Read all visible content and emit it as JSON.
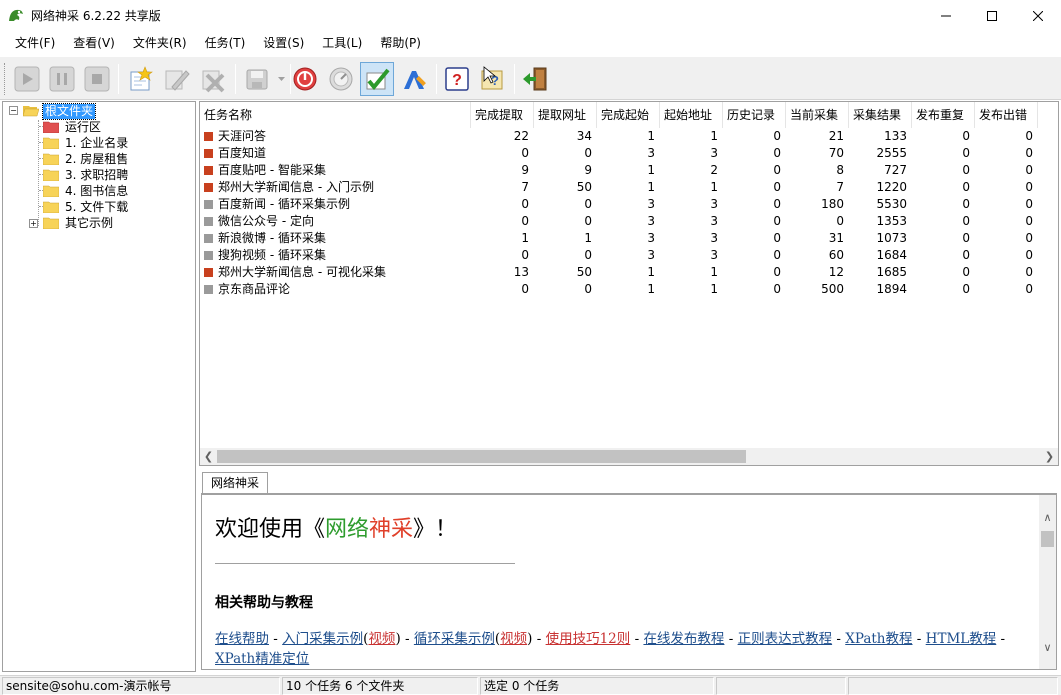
{
  "window": {
    "title": "网络神采 6.2.22 共享版"
  },
  "menu": [
    {
      "label": "文件(F)"
    },
    {
      "label": "查看(V)"
    },
    {
      "label": "文件夹(R)"
    },
    {
      "label": "任务(T)"
    },
    {
      "label": "设置(S)"
    },
    {
      "label": "工具(L)"
    },
    {
      "label": "帮助(P)"
    }
  ],
  "toolbar": [
    {
      "icon": "play-icon",
      "enabled": false
    },
    {
      "icon": "pause-icon",
      "enabled": false
    },
    {
      "icon": "stop-icon",
      "enabled": false
    },
    {
      "icon": "new-task-icon",
      "enabled": true
    },
    {
      "icon": "edit-task-icon",
      "enabled": false
    },
    {
      "icon": "delete-task-icon",
      "enabled": false
    },
    {
      "icon": "save-icon",
      "enabled": false
    },
    {
      "icon": "power-icon",
      "enabled": true
    },
    {
      "icon": "gauge-icon",
      "enabled": false
    },
    {
      "icon": "check-icon",
      "enabled": true,
      "active": true
    },
    {
      "icon": "test-tools-icon",
      "enabled": true
    },
    {
      "icon": "help-icon",
      "enabled": true
    },
    {
      "icon": "context-help-icon",
      "enabled": true
    },
    {
      "icon": "exit-icon",
      "enabled": true
    }
  ],
  "tree": {
    "root": "根文件夹",
    "items": [
      {
        "label": "运行区",
        "folder_color": "#e05050"
      },
      {
        "label": "1. 企业名录",
        "folder_color": "#f7d358"
      },
      {
        "label": "2. 房屋租售",
        "folder_color": "#f7d358"
      },
      {
        "label": "3. 求职招聘",
        "folder_color": "#f7d358"
      },
      {
        "label": "4. 图书信息",
        "folder_color": "#f7d358"
      },
      {
        "label": "5. 文件下载",
        "folder_color": "#f7d358"
      },
      {
        "label": "其它示例",
        "folder_color": "#f7d358",
        "expandable": true
      }
    ]
  },
  "grid": {
    "columns": [
      "任务名称",
      "完成提取",
      "提取网址",
      "完成起始",
      "起始地址",
      "历史记录",
      "当前采集",
      "采集结果",
      "发布重复",
      "发布出错"
    ],
    "rows": [
      {
        "state": "red",
        "cells": [
          "天涯问答",
          "22",
          "34",
          "1",
          "1",
          "0",
          "21",
          "133",
          "0",
          "0"
        ]
      },
      {
        "state": "red",
        "cells": [
          "百度知道",
          "0",
          "0",
          "3",
          "3",
          "0",
          "70",
          "2555",
          "0",
          "0"
        ]
      },
      {
        "state": "red",
        "cells": [
          "百度贴吧 - 智能采集",
          "9",
          "9",
          "1",
          "2",
          "0",
          "8",
          "727",
          "0",
          "0"
        ]
      },
      {
        "state": "red",
        "cells": [
          "郑州大学新闻信息 - 入门示例",
          "7",
          "50",
          "1",
          "1",
          "0",
          "7",
          "1220",
          "0",
          "0"
        ]
      },
      {
        "state": "gray",
        "cells": [
          "百度新闻 - 循环采集示例",
          "0",
          "0",
          "3",
          "3",
          "0",
          "180",
          "5530",
          "0",
          "0"
        ]
      },
      {
        "state": "gray",
        "cells": [
          "微信公众号 - 定向",
          "0",
          "0",
          "3",
          "3",
          "0",
          "0",
          "1353",
          "0",
          "0"
        ]
      },
      {
        "state": "gray",
        "cells": [
          "新浪微博 - 循环采集",
          "1",
          "1",
          "3",
          "3",
          "0",
          "31",
          "1073",
          "0",
          "0"
        ]
      },
      {
        "state": "gray",
        "cells": [
          "搜狗视频 - 循环采集",
          "0",
          "0",
          "3",
          "3",
          "0",
          "60",
          "1684",
          "0",
          "0"
        ]
      },
      {
        "state": "red",
        "cells": [
          "郑州大学新闻信息 - 可视化采集",
          "13",
          "50",
          "1",
          "1",
          "0",
          "12",
          "1685",
          "0",
          "0"
        ]
      },
      {
        "state": "gray",
        "cells": [
          "京东商品评论",
          "0",
          "0",
          "1",
          "1",
          "0",
          "500",
          "1894",
          "0",
          "0"
        ]
      }
    ],
    "state_colors": {
      "red": "#c8401e",
      "gray": "#9a9a9a"
    }
  },
  "tabs": [
    {
      "label": "网络神采"
    }
  ],
  "browser": {
    "welcome_prefix": "欢迎使用《",
    "welcome_g1": "网络",
    "welcome_r1": "神采",
    "welcome_suffix": "》！",
    "section_title": "相关帮助与教程",
    "links": [
      {
        "text": "在线帮助",
        "hot": false,
        "sep": " - "
      },
      {
        "text": "入门采集示例",
        "hot": false,
        "paren": "视频",
        "sep": " - "
      },
      {
        "text": "循环采集示例",
        "hot": false,
        "paren": "视频",
        "sep": " - "
      },
      {
        "text": "使用技巧12则",
        "hot": true,
        "sep": " - "
      },
      {
        "text": "在线发布教程",
        "hot": false,
        "sep": " - "
      },
      {
        "text": "正则表达式教程",
        "hot": false,
        "sep": " - "
      },
      {
        "text": "XPath教程",
        "hot": false,
        "sep": " - "
      },
      {
        "text": "HTML教程",
        "hot": false,
        "sep": " - "
      },
      {
        "text": "XPath精准定位",
        "hot": false,
        "sep": ""
      }
    ]
  },
  "status": {
    "account": "sensite@sohu.com-演示帐号",
    "counts": "10 个任务   6 个文件夹",
    "selection": "选定 0 个任务"
  }
}
